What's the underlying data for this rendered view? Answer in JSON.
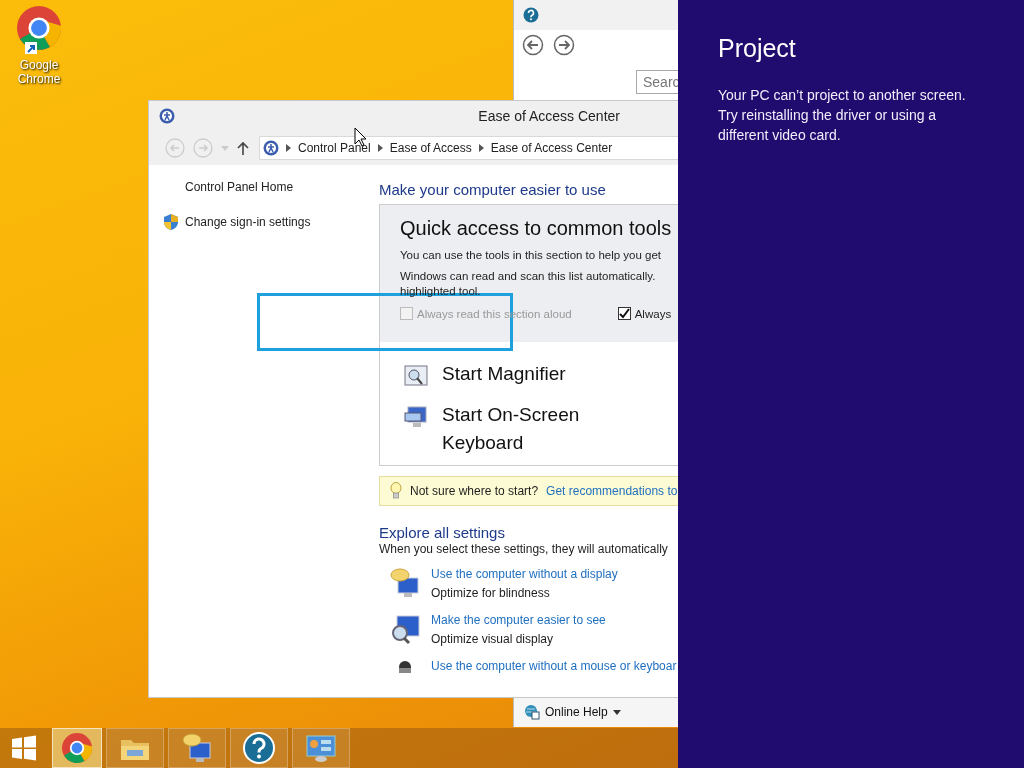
{
  "desktop_icons": [
    {
      "label": "Google Chrome",
      "kind": "chrome"
    }
  ],
  "help_window": {
    "search": {
      "placeholder": "Searc"
    },
    "online_help": "Online Help"
  },
  "window": {
    "title": "Ease of Access Center",
    "breadcrumb": [
      "Control Panel",
      "Ease of Access",
      "Ease of Access Center"
    ],
    "sidebar": {
      "items": [
        {
          "label": "Control Panel Home",
          "kind": "plain"
        },
        {
          "label": "Change sign-in settings",
          "kind": "shield"
        }
      ]
    },
    "heading": "Make your computer easier to use",
    "quick_access": {
      "title": "Quick access to common tools",
      "lines": [
        "You can use the tools in this section to help you get",
        "Windows can read and scan this list automatically.",
        "highlighted tool."
      ],
      "checkboxes": [
        {
          "label": "Always read this section aloud",
          "checked": false,
          "disabled": true
        },
        {
          "label": "Always",
          "checked": true,
          "disabled": false
        }
      ],
      "tools": [
        {
          "label": "Start Magnifier",
          "kind": "magnifier"
        },
        {
          "label": "Start On-Screen Keyboard",
          "kind": "keyboard"
        }
      ]
    },
    "tip": {
      "text": "Not sure where to start?",
      "link": "Get recommendations to"
    },
    "explore": {
      "title": "Explore all settings",
      "description": "When you select these settings, they will automatically",
      "items": [
        {
          "link": "Use the computer without a display",
          "description": "Optimize for blindness",
          "kind": "narrator"
        },
        {
          "link": "Make the computer easier to see",
          "description": "Optimize visual display",
          "kind": "magnify"
        },
        {
          "link": "Use the computer without a mouse or keyboar",
          "kind": "person"
        }
      ]
    }
  },
  "taskbar": {
    "items": [
      {
        "kind": "start",
        "selected": false
      },
      {
        "kind": "chrome",
        "selected": true
      },
      {
        "kind": "folder",
        "selected": false
      },
      {
        "kind": "narrator",
        "selected": false
      },
      {
        "kind": "help",
        "selected": false
      },
      {
        "kind": "control-panel",
        "selected": false
      }
    ]
  },
  "charm": {
    "title": "Project",
    "message": "Your PC can’t project to another screen. Try reinstalling the driver or using a different video card."
  }
}
